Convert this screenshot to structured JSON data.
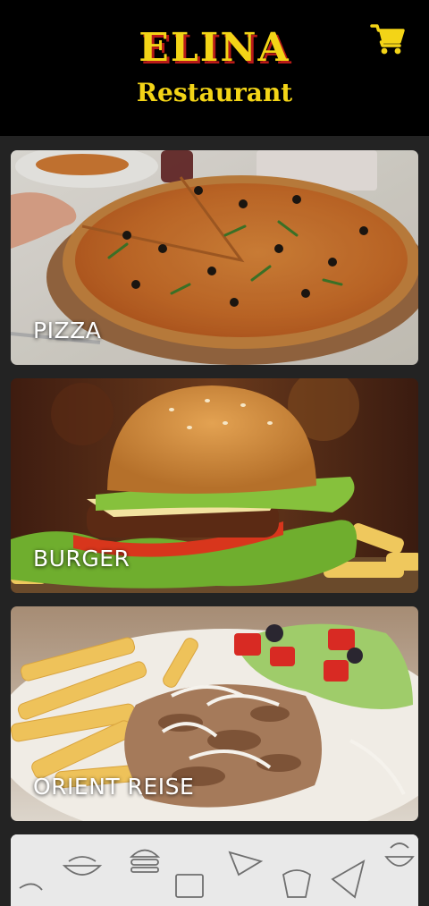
{
  "header": {
    "brand": "ELINA",
    "subtitle": "Restaurant",
    "cart_icon": "shopping-cart-icon"
  },
  "colors": {
    "background": "#232323",
    "header_bg": "#000000",
    "brand_yellow": "#f3d417",
    "brand_red": "#c41d1b"
  },
  "categories": [
    {
      "label": "PIZZA",
      "image": "pizza-photo"
    },
    {
      "label": "BURGER",
      "image": "burger-photo"
    },
    {
      "label": "ORIENT REISE",
      "image": "gyros-fries-salad-photo"
    },
    {
      "label": "",
      "image": "food-doodle-pattern"
    }
  ]
}
